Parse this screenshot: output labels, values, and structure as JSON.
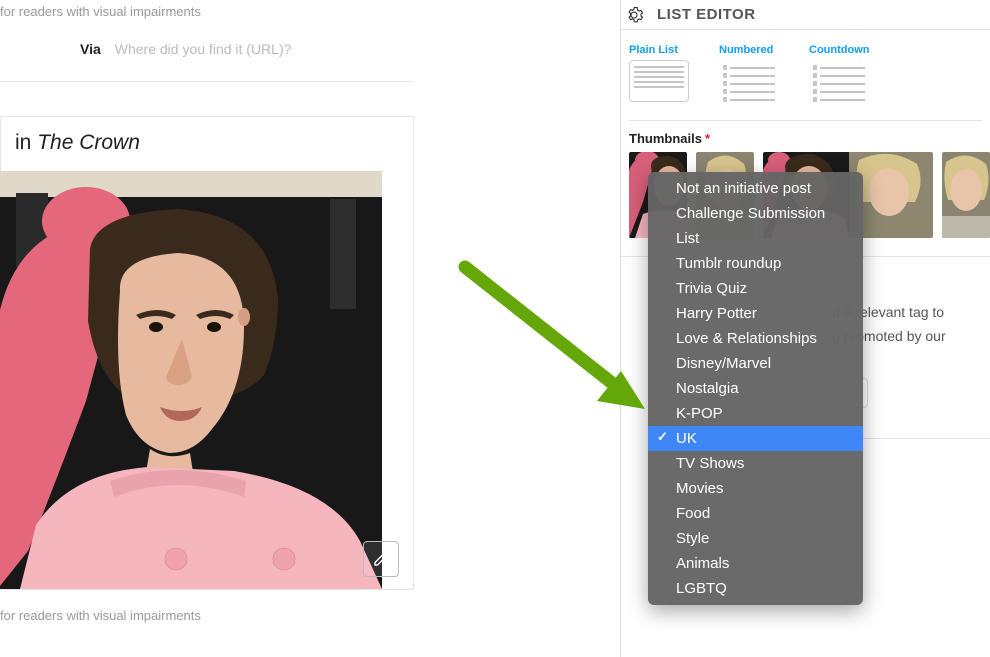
{
  "left": {
    "alt_text_top": "for readers with visual impairments",
    "via_label": "Via",
    "via_placeholder": "Where did you find it (URL)?",
    "headline_prefix": "in ",
    "headline_title": "The Crown",
    "alt_text_bottom": "for readers with visual impairments"
  },
  "panel": {
    "title": "LIST EDITOR",
    "list_types": [
      {
        "label": "Plain List",
        "kind": "plain",
        "selected": true
      },
      {
        "label": "Numbered",
        "kind": "numbered",
        "selected": false
      },
      {
        "label": "Countdown",
        "kind": "countdown",
        "selected": false
      }
    ],
    "thumbnails_label": "Thumbnails",
    "hint_text_1": "d a relevant tag to",
    "hint_text_2": "g promoted by our"
  },
  "dropdown": {
    "items": [
      "Not an initiative post",
      "Challenge Submission",
      "List",
      "Tumblr roundup",
      "Trivia Quiz",
      "Harry Potter",
      "Love & Relationships",
      "Disney/Marvel",
      "Nostalgia",
      "K-POP",
      "UK",
      "TV Shows",
      "Movies",
      "Food",
      "Style",
      "Animals",
      "LGBTQ"
    ],
    "selected": "UK"
  }
}
